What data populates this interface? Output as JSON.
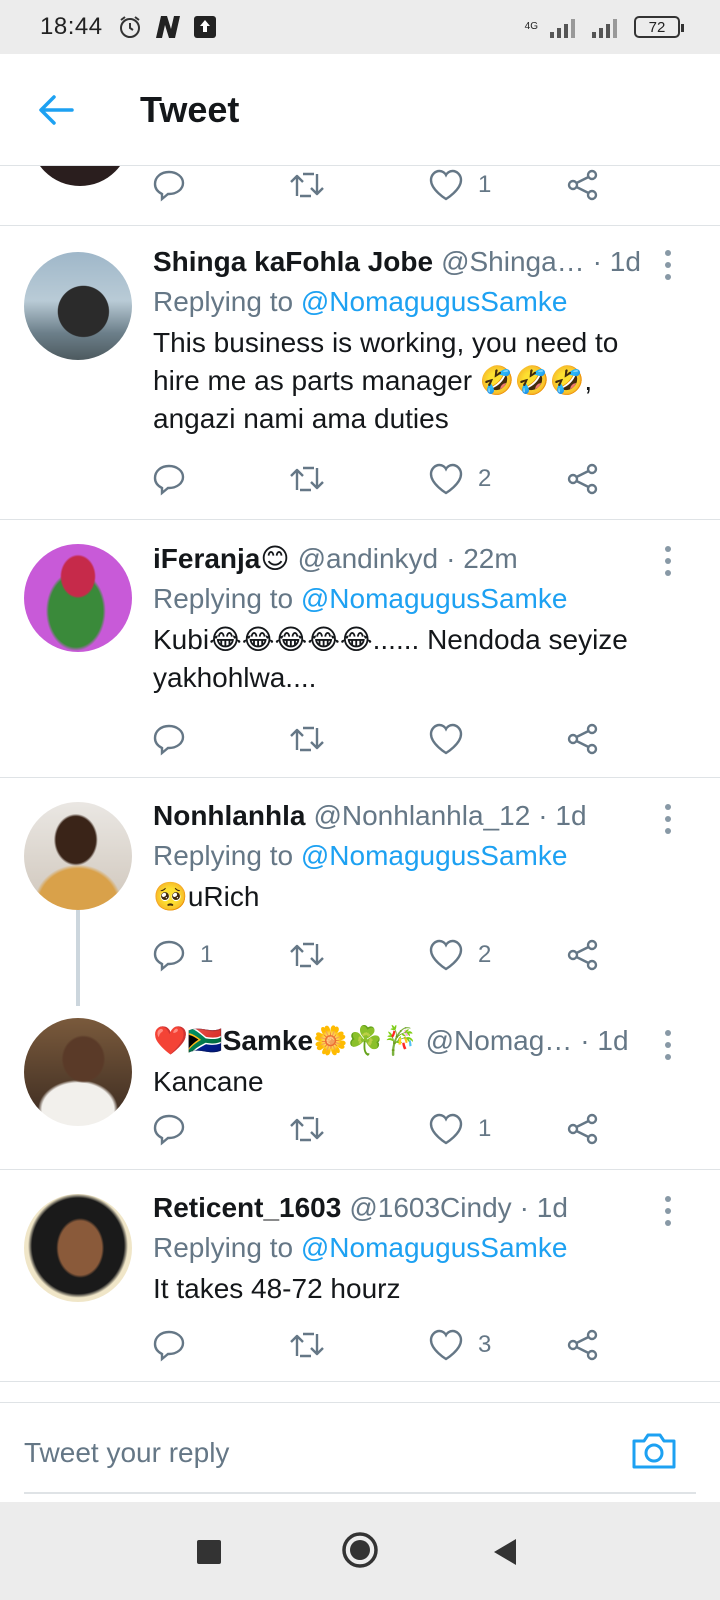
{
  "status_bar": {
    "time": "18:44",
    "battery": "72",
    "network": "4G"
  },
  "header": {
    "title": "Tweet"
  },
  "partial_tweet": {
    "like_count": "1"
  },
  "tweets": [
    {
      "name": "Shinga kaFohla Jobe",
      "handle": "@Shinga…",
      "time": "· 1d",
      "replying_prefix": "Replying to",
      "replying_to": "@NomagugusSamke",
      "text": "This business is working, you need to hire me as parts manager 🤣🤣🤣, angazi nami ama duties",
      "reply_count": "",
      "like_count": "2"
    },
    {
      "name": "iFeranja😊",
      "handle": "@andinkyd",
      "time": "· 22m",
      "replying_prefix": "Replying to",
      "replying_to": "@NomagugusSamke",
      "text": "Kubi😂😂😂😂😂...... Nendoda seyize yakhohlwa....",
      "reply_count": "",
      "like_count": ""
    },
    {
      "name": "Nonhlanhla",
      "handle": "@Nonhlanhla_12",
      "time": "· 1d",
      "replying_prefix": "Replying to",
      "replying_to": "@NomagugusSamke",
      "text": "🥺uRich",
      "reply_count": "1",
      "like_count": "2"
    },
    {
      "name": "❤️🇿🇦Samke🌼☘️🎋",
      "handle": "@Nomag…",
      "time": "· 1d",
      "text": "Kancane",
      "reply_count": "",
      "like_count": "1"
    },
    {
      "name": "Reticent_1603",
      "handle": "@1603Cindy",
      "time": "· 1d",
      "replying_prefix": "Replying to",
      "replying_to": "@NomagugusSamke",
      "text": "It takes 48-72 hourz",
      "reply_count": "",
      "like_count": "3"
    }
  ],
  "reply_bar": {
    "placeholder": "Tweet your reply"
  },
  "colors": {
    "accent": "#1da1f2",
    "muted": "#657786",
    "divider": "#dfe3e6"
  }
}
